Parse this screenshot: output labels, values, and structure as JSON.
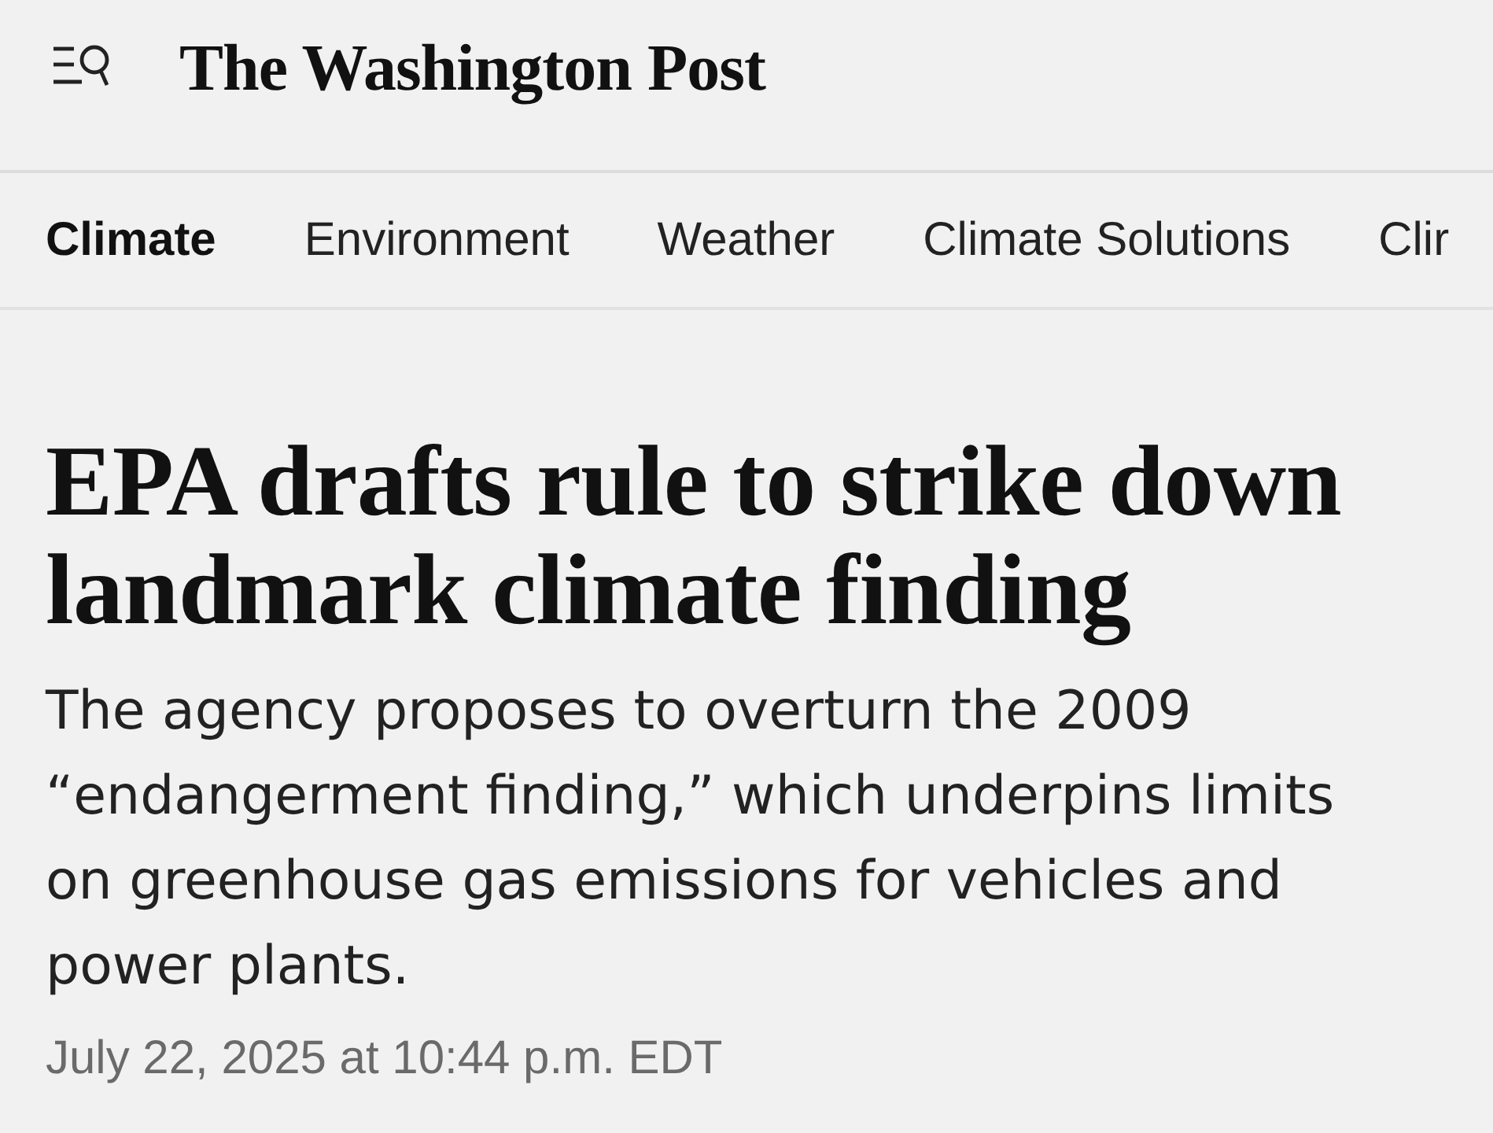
{
  "header": {
    "logo": "The Washington Post"
  },
  "nav": {
    "tabs": [
      {
        "label": "Climate",
        "selected": true
      },
      {
        "label": "Environment",
        "selected": false
      },
      {
        "label": "Weather",
        "selected": false
      },
      {
        "label": "Climate Solutions",
        "selected": false
      },
      {
        "label": "Clir",
        "selected": false
      }
    ]
  },
  "article": {
    "headline": "EPA drafts rule to strike down landmark climate finding",
    "dek": "The agency proposes to overturn the 2009 “endangerment finding,” which underpins limits on greenhouse gas emissions for vehicles and power plants.",
    "timestamp": "July 22, 2025 at 10:44 p.m. EDT"
  }
}
